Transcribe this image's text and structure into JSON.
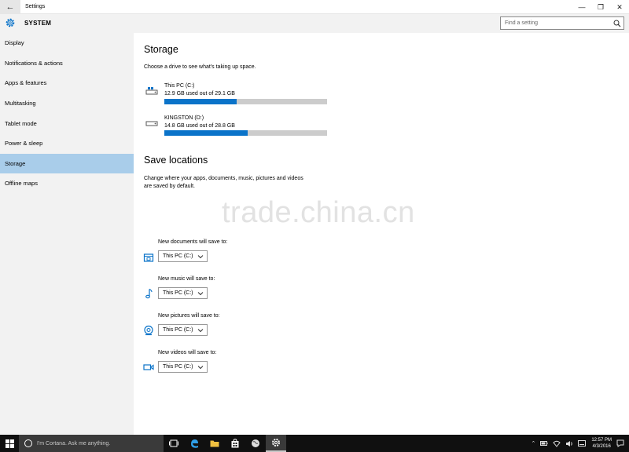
{
  "window": {
    "title": "Settings",
    "back_glyph": "←",
    "minimize_glyph": "—",
    "restore_glyph": "❐",
    "close_glyph": "✕"
  },
  "header": {
    "section": "SYSTEM",
    "search_placeholder": "Find a setting"
  },
  "sidebar": {
    "items": [
      {
        "label": "Display"
      },
      {
        "label": "Notifications & actions"
      },
      {
        "label": "Apps & features"
      },
      {
        "label": "Multitasking"
      },
      {
        "label": "Tablet mode"
      },
      {
        "label": "Power & sleep"
      },
      {
        "label": "Storage",
        "selected": true
      },
      {
        "label": "Offline maps"
      }
    ]
  },
  "storage": {
    "title": "Storage",
    "subtitle": "Choose a drive to see what's taking up space.",
    "drives": [
      {
        "name": "This PC (C:)",
        "usage": "12.9 GB used out of 29.1 GB",
        "used_fraction": 0.443,
        "icon": "windows-drive-icon"
      },
      {
        "name": "KINGSTON (D:)",
        "usage": "14.8 GB used out of 28.8 GB",
        "used_fraction": 0.514,
        "icon": "usb-drive-icon"
      }
    ]
  },
  "save_locations": {
    "title": "Save locations",
    "description_line1": "Change where your apps, documents, music, pictures and videos",
    "description_line2": "are saved by default.",
    "items": [
      {
        "label": "New documents will save to:",
        "value": "This PC (C:)",
        "icon": "documents-icon"
      },
      {
        "label": "New music will save to:",
        "value": "This PC (C:)",
        "icon": "music-icon"
      },
      {
        "label": "New pictures will save to:",
        "value": "This PC (C:)",
        "icon": "pictures-icon"
      },
      {
        "label": "New videos will save to:",
        "value": "This PC (C:)",
        "icon": "videos-icon"
      }
    ]
  },
  "watermark": "trade.china.cn",
  "taskbar": {
    "cortana_placeholder": "I'm Cortana. Ask me anything.",
    "time": "12:57 PM",
    "date": "4/3/2016"
  },
  "colors": {
    "accent": "#0a73c9",
    "selection": "#a9cdea",
    "sidebar_bg": "#f2f2f2",
    "taskbar_bg": "#101010"
  }
}
